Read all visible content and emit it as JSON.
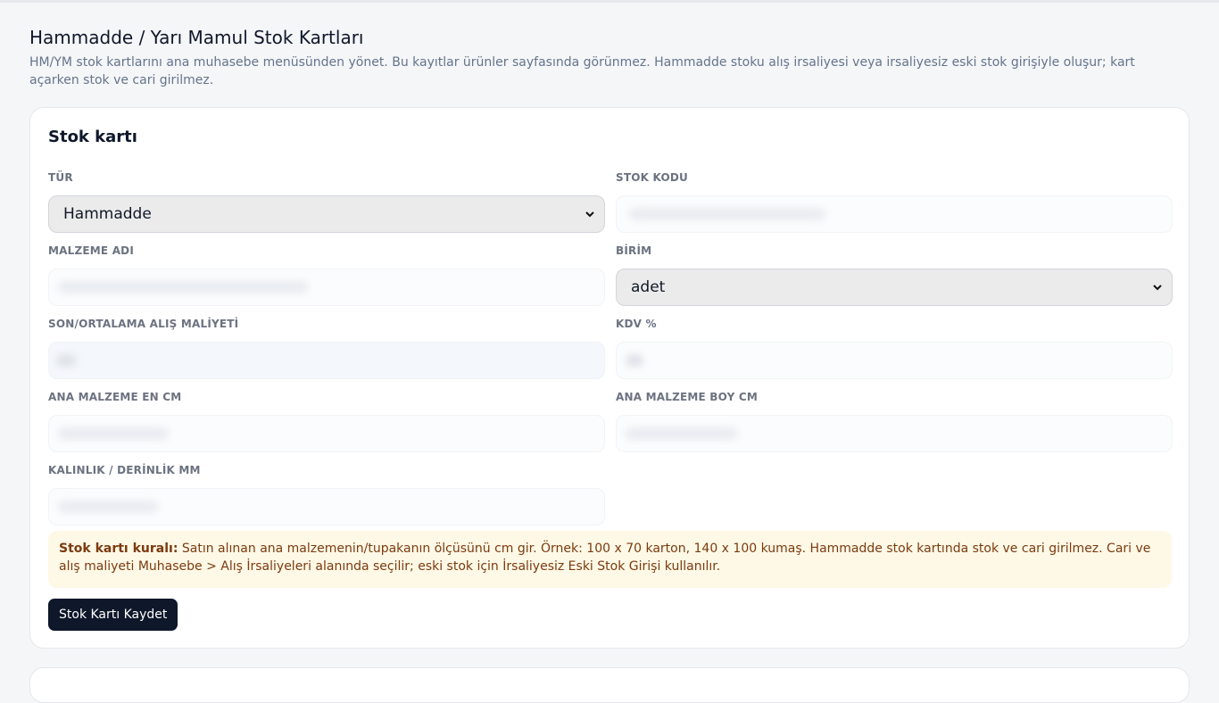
{
  "page": {
    "title": "Hammadde / Yarı Mamul Stok Kartları",
    "description": "HM/YM stok kartlarını ana muhasebe menüsünden yönet. Bu kayıtlar ürünler sayfasında görünmez. Hammadde stoku alış irsaliyesi veya irsaliyesiz eski stok girişiyle oluşur; kart açarken stok ve cari girilmez."
  },
  "card": {
    "title": "Stok kartı",
    "fields": {
      "tur": {
        "label": "TÜR",
        "value": "Hammadde"
      },
      "stok_kodu": {
        "label": "STOK KODU",
        "value": ""
      },
      "malzeme_adi": {
        "label": "MALZEME ADI",
        "value": ""
      },
      "birim": {
        "label": "BİRİM",
        "value": "adet"
      },
      "maliyet": {
        "label": "SON/ORTALAMA ALIŞ MALİYETİ",
        "value": ""
      },
      "kdv": {
        "label": "KDV %",
        "value": ""
      },
      "en_cm": {
        "label": "ANA MALZEME EN CM",
        "value": ""
      },
      "boy_cm": {
        "label": "ANA MALZEME BOY CM",
        "value": ""
      },
      "kalinlik": {
        "label": "KALINLIK / DERİNLİK MM",
        "value": ""
      }
    },
    "note": {
      "bold": "Stok kartı kuralı:",
      "text": " Satın alınan ana malzemenin/tupakanın ölçüsünü cm gir. Örnek: 100 x 70 karton, 140 x 100 kumaş. Hammadde stok kartında stok ve cari girilmez. Cari ve alış maliyeti Muhasebe > Alış İrsaliyeleri alanında seçilir; eski stok için İrsaliyesiz Eski Stok Girişi kullanılır."
    },
    "save_label": "Stok Kartı Kaydet"
  },
  "icons": {
    "select_chevron": "chevron-down-icon"
  }
}
